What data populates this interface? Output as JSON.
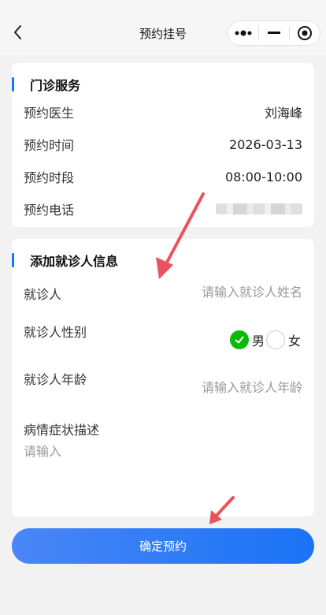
{
  "navbar": {
    "title": "预约挂号",
    "back_icon": "chevron-left-icon",
    "capsule": {
      "more_icon": "more-dots-icon",
      "minimize_icon": "minimize-icon",
      "close_icon": "target-close-icon"
    }
  },
  "appointment": {
    "section_title": "门诊服务",
    "rows": [
      {
        "label": "预约医生",
        "value": "刘海峰"
      },
      {
        "label": "预约时间",
        "value": "2026-03-13"
      },
      {
        "label": "预约时段",
        "value": "08:00-10:00"
      },
      {
        "label": "预约电话",
        "value": ""
      }
    ]
  },
  "patient": {
    "section_title": "添加就诊人信息",
    "name": {
      "label": "就诊人",
      "placeholder": "请输入就诊人姓名"
    },
    "gender": {
      "label": "就诊人性别",
      "options": [
        "男",
        "女"
      ],
      "selected": "男"
    },
    "age": {
      "label": "就诊人年龄",
      "placeholder": "请输入就诊人年龄"
    },
    "symptoms": {
      "label": "病情症状描述",
      "placeholder": "请输入"
    }
  },
  "submit": {
    "label": "确定预约"
  },
  "colors": {
    "accent": "#1677ff",
    "check": "#09bb07",
    "arrow": "#e9535c"
  }
}
